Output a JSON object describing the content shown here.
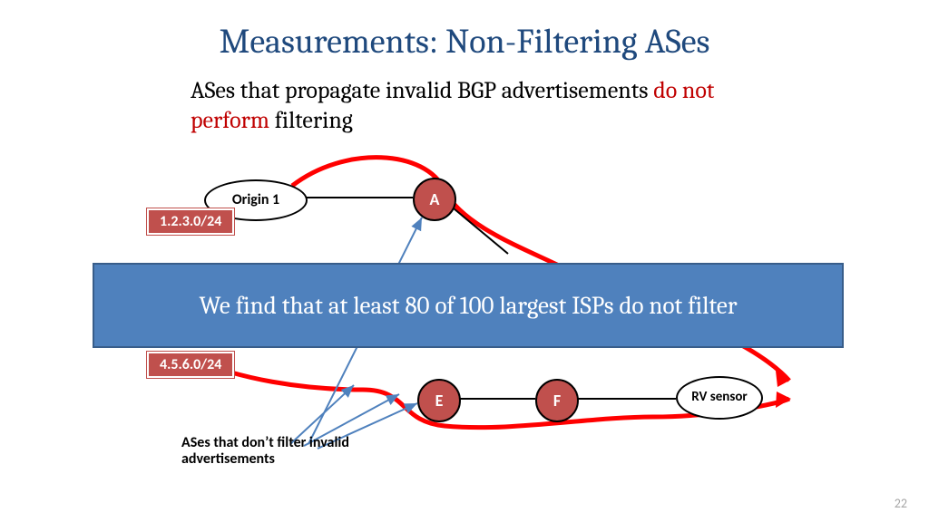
{
  "title": "Measurements: Non-Filtering ASes",
  "subtitle": {
    "pre": "ASes that propagate invalid BGP advertisements ",
    "hl": "do not perform",
    "post": " filtering"
  },
  "nodes": {
    "origin1": "Origin 1",
    "A": "A",
    "E": "E",
    "F": "F",
    "rv": "RV sensor"
  },
  "prefixes": {
    "p1": "1.2.3.0/24",
    "p2": "4.5.6.0/24"
  },
  "banner": "We find that at least 80 of 100 largest ISPs do not filter",
  "note": "ASes that don’t filter invalid advertisements",
  "page": "22"
}
